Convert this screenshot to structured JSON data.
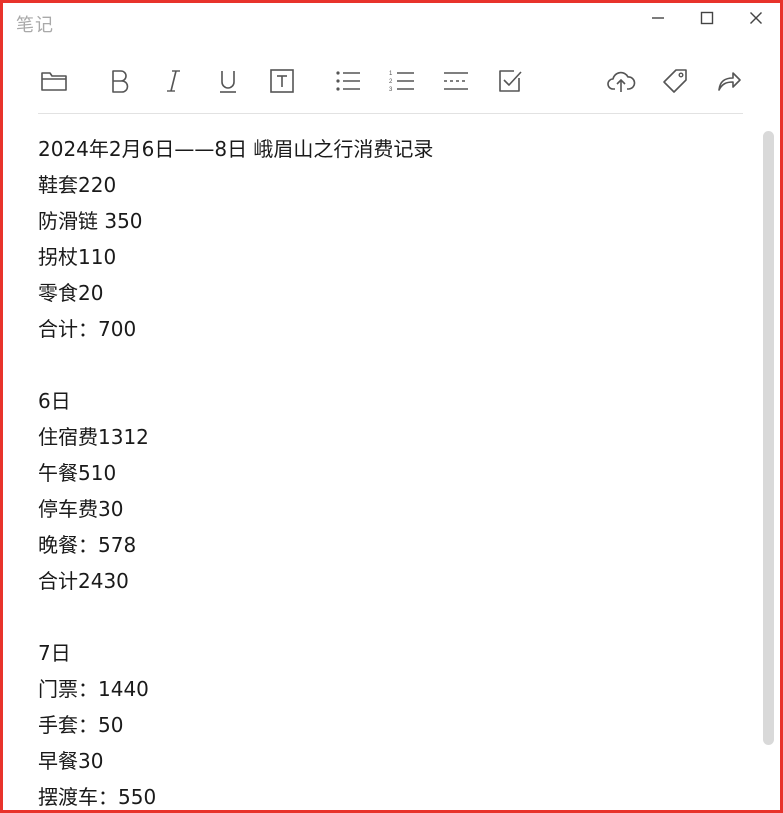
{
  "window": {
    "title": "笔记"
  },
  "toolbar": {
    "left": [
      {
        "name": "folder-icon"
      },
      {
        "name": "bold-icon"
      },
      {
        "name": "italic-icon"
      },
      {
        "name": "underline-icon"
      },
      {
        "name": "text-box-icon"
      },
      {
        "name": "bullet-list-icon"
      },
      {
        "name": "numbered-list-icon"
      },
      {
        "name": "divider-line-icon"
      },
      {
        "name": "checkbox-icon"
      }
    ],
    "right": [
      {
        "name": "cloud-upload-icon"
      },
      {
        "name": "tag-icon"
      },
      {
        "name": "share-icon"
      }
    ]
  },
  "note": {
    "lines": [
      "2024年2月6日——8日 峨眉山之行消费记录",
      "鞋套220",
      "防滑链 350",
      "拐杖110",
      "零食20",
      "合计：700",
      "",
      "6日",
      "住宿费1312",
      "午餐510",
      "停车费30",
      "晚餐：578",
      "合计2430",
      "",
      "7日",
      "门票：1440",
      "手套：50",
      "早餐30",
      "摆渡车：550"
    ]
  },
  "colors": {
    "border": "#e8332b",
    "icon": "#555555",
    "title": "#a9a9a9",
    "text": "#1a1a1a"
  }
}
